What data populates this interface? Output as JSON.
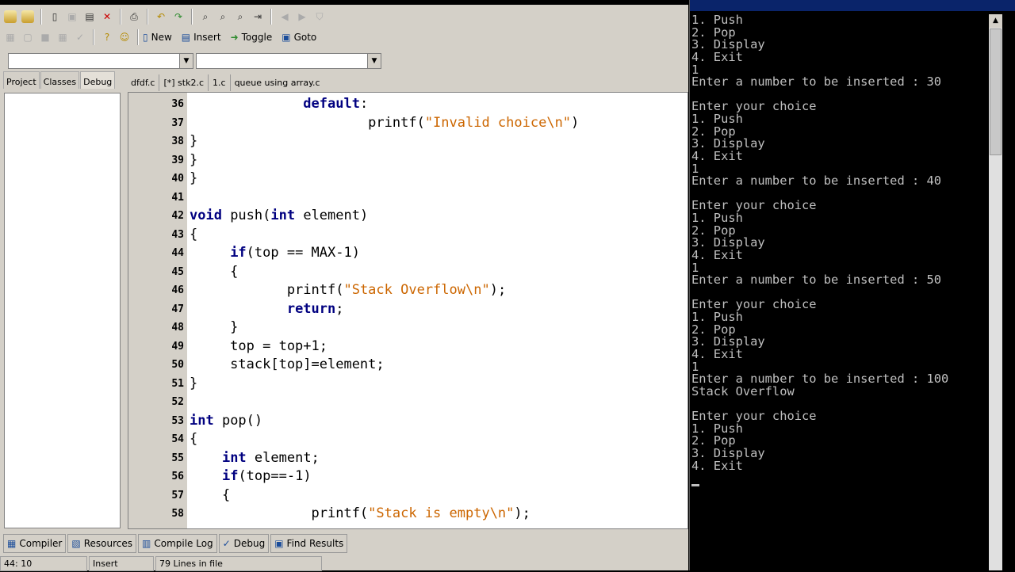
{
  "toolbar": {
    "new_label": "New",
    "insert_label": "Insert",
    "toggle_label": "Toggle",
    "goto_label": "Goto"
  },
  "project_tabs": [
    "Project",
    "Classes",
    "Debug"
  ],
  "editor_tabs": [
    "dfdf.c",
    "[*] stk2.c",
    "1.c",
    "queue using array.c"
  ],
  "code_lines": [
    {
      "n": "36",
      "parts": [
        {
          "t": "              "
        },
        {
          "t": "default",
          "c": "kw"
        },
        {
          "t": ":"
        }
      ]
    },
    {
      "n": "37",
      "parts": [
        {
          "t": "                      printf("
        },
        {
          "t": "\"Invalid choice\\n\"",
          "c": "str"
        },
        {
          "t": ")"
        }
      ]
    },
    {
      "n": "38",
      "parts": [
        {
          "t": "}"
        }
      ]
    },
    {
      "n": "39",
      "parts": [
        {
          "t": "}"
        }
      ]
    },
    {
      "n": "40",
      "parts": [
        {
          "t": "}"
        }
      ]
    },
    {
      "n": "41",
      "parts": [
        {
          "t": ""
        }
      ]
    },
    {
      "n": "42",
      "parts": [
        {
          "t": "void",
          "c": "kw"
        },
        {
          "t": " push("
        },
        {
          "t": "int",
          "c": "kw"
        },
        {
          "t": " element)"
        }
      ]
    },
    {
      "n": "43",
      "parts": [
        {
          "t": "{"
        }
      ]
    },
    {
      "n": "44",
      "parts": [
        {
          "t": "     "
        },
        {
          "t": "if",
          "c": "kw"
        },
        {
          "t": "(top == MAX-1)"
        }
      ]
    },
    {
      "n": "45",
      "parts": [
        {
          "t": "     {"
        }
      ]
    },
    {
      "n": "46",
      "parts": [
        {
          "t": "            printf("
        },
        {
          "t": "\"Stack Overflow\\n\"",
          "c": "str"
        },
        {
          "t": ");"
        }
      ]
    },
    {
      "n": "47",
      "parts": [
        {
          "t": "            "
        },
        {
          "t": "return",
          "c": "kw"
        },
        {
          "t": ";"
        }
      ]
    },
    {
      "n": "48",
      "parts": [
        {
          "t": "     }"
        }
      ]
    },
    {
      "n": "49",
      "parts": [
        {
          "t": "     top = top+1;"
        }
      ]
    },
    {
      "n": "50",
      "parts": [
        {
          "t": "     stack[top]=element;"
        }
      ]
    },
    {
      "n": "51",
      "parts": [
        {
          "t": "}"
        }
      ]
    },
    {
      "n": "52",
      "parts": [
        {
          "t": ""
        }
      ]
    },
    {
      "n": "53",
      "parts": [
        {
          "t": "int",
          "c": "kw"
        },
        {
          "t": " pop()"
        }
      ]
    },
    {
      "n": "54",
      "parts": [
        {
          "t": "{"
        }
      ]
    },
    {
      "n": "55",
      "parts": [
        {
          "t": "    "
        },
        {
          "t": "int",
          "c": "kw"
        },
        {
          "t": " element;"
        }
      ]
    },
    {
      "n": "56",
      "parts": [
        {
          "t": "    "
        },
        {
          "t": "if",
          "c": "kw"
        },
        {
          "t": "(top==-1)"
        }
      ]
    },
    {
      "n": "57",
      "parts": [
        {
          "t": "    {"
        }
      ]
    },
    {
      "n": "58",
      "parts": [
        {
          "t": "               printf("
        },
        {
          "t": "\"Stack is empty\\n\"",
          "c": "str"
        },
        {
          "t": ");"
        }
      ]
    }
  ],
  "bottom_tabs": [
    "Compiler",
    "Resources",
    "Compile Log",
    "Debug",
    "Find Results"
  ],
  "status": {
    "position": "44: 10",
    "mode": "Insert",
    "lines": "79 Lines in file"
  },
  "console_lines": [
    "1. Push",
    "2. Pop",
    "3. Display",
    "4. Exit",
    "1",
    "Enter a number to be inserted : 30",
    "",
    "Enter your choice",
    "1. Push",
    "2. Pop",
    "3. Display",
    "4. Exit",
    "1",
    "Enter a number to be inserted : 40",
    "",
    "Enter your choice",
    "1. Push",
    "2. Pop",
    "3. Display",
    "4. Exit",
    "1",
    "Enter a number to be inserted : 50",
    "",
    "Enter your choice",
    "1. Push",
    "2. Pop",
    "3. Display",
    "4. Exit",
    "1",
    "Enter a number to be inserted : 100",
    "Stack Overflow",
    "",
    "Enter your choice",
    "1. Push",
    "2. Pop",
    "3. Display",
    "4. Exit"
  ],
  "icons": {
    "toolbar1": [
      "open-project-icon",
      "close-project-icon",
      "new-file-icon",
      "save-icon",
      "save-all-icon",
      "close-file-icon",
      "print-icon",
      "undo-icon",
      "redo-icon",
      "find-icon",
      "replace-icon",
      "find-next-icon",
      "goto-line-icon",
      "back-icon",
      "forward-icon",
      "shield-icon"
    ],
    "toolbar2": [
      "compile-icon",
      "run-icon",
      "compile-run-icon",
      "rebuild-icon",
      "check-icon",
      "help-icon",
      "about-icon"
    ]
  }
}
